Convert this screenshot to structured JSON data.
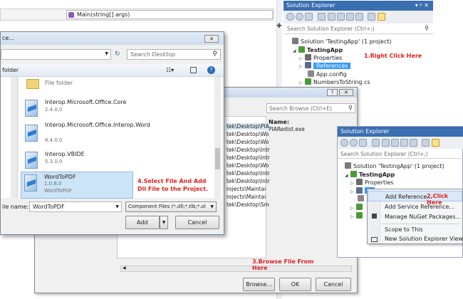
{
  "code_bar": {
    "method": "Main(string[] args)"
  },
  "se_main": {
    "title": "Solution Explorer",
    "pin": "▾ ᵖ ✕",
    "search_placeholder": "Search Solution Explorer (Ctrl+;)",
    "items": [
      "Solution 'TestingApp' (1 project)",
      "TestingApp",
      "Properties",
      "References",
      "App.config",
      "NumbersToString.cs"
    ]
  },
  "annotations": {
    "a1": "1.Right Click Here",
    "a2": "2.Click Here",
    "a3": "3.Browse File From Here",
    "a4": "4.Select File And Add Dll File to the Project."
  },
  "browse_dialog": {
    "title": "ce...",
    "search_placeholder": "Search Desktop",
    "breadcrumb_label": "folder",
    "files": [
      {
        "name": "File folder",
        "version": ""
      },
      {
        "name": "Interop.Microsoft.Office.Core",
        "version": "2.4.0.0"
      },
      {
        "name": "Interop.Microsoft.Office.Interop.Word",
        "version": "8.4.0.0"
      },
      {
        "name": "Interop.VBIDE",
        "version": "5.3.0.0"
      },
      {
        "name": "WordToPDF",
        "version": "1.0.8.0"
      }
    ],
    "last_version_2": "WordToPDF",
    "file_name_label": "ile name:",
    "file_name_value": "WordToPDF",
    "file_type": "Component Files (*.dll;*.tlb;*.ol",
    "add": "Add",
    "cancel": "Cancel"
  },
  "ref_manager": {
    "search_placeholder": "Search Browse (Ctrl+E)",
    "name_label": "Name:",
    "name_value": "PIARedist.exe",
    "paths": [
      "tek\\Desktop\\PIA",
      "tek\\Desktop\\Wo",
      "tek\\Desktop\\Wo",
      "tek\\Desktop\\Intr",
      "tek\\Desktop\\Intr",
      "tek\\Desktop\\Wo",
      "tek\\Desktop\\Intr",
      "tek\\Desktop\\Intr",
      "rojects\\Maintai",
      "rojects\\Maintai",
      "tek\\Desktop\\Sm"
    ],
    "browse": "Browse...",
    "ok": "OK",
    "cancel": "Cancel"
  },
  "se_second": {
    "title": "Solution Explorer",
    "search_placeholder": "Search Solution Explorer (Ctrl+;)",
    "items": [
      "Solution 'TestingApp' (1 project)",
      "TestingApp",
      "Properties"
    ],
    "menu": [
      "Add Reference...",
      "Add Service Reference...",
      "Manage NuGet Packages...",
      "Scope to This",
      "New Solution Explorer View"
    ]
  }
}
